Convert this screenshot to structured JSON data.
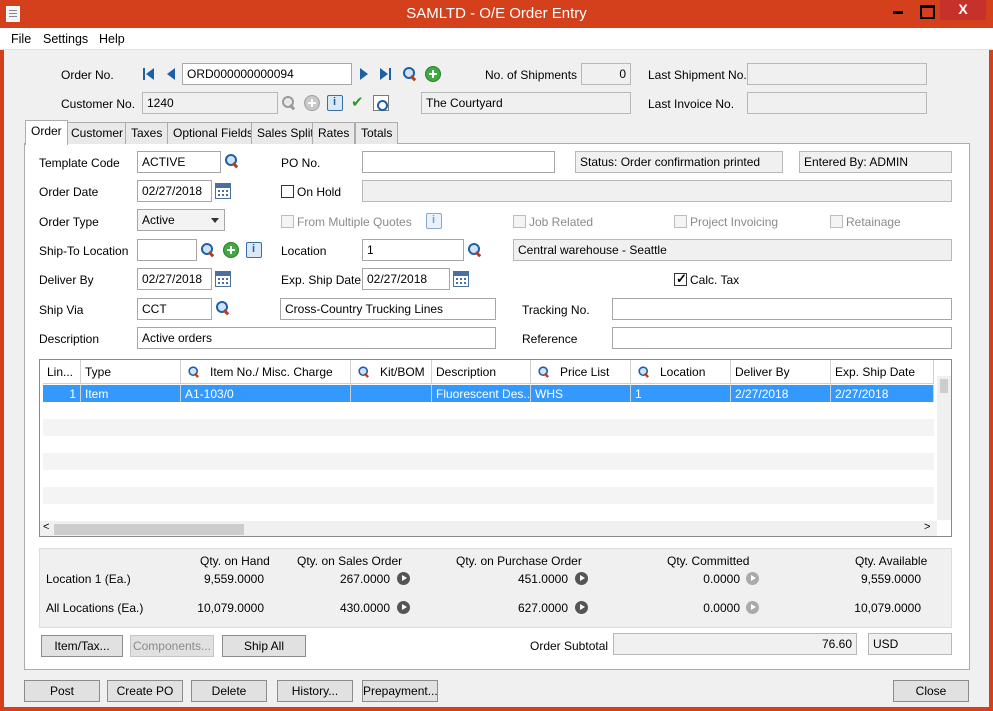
{
  "window": {
    "title": "SAMLTD - O/E Order Entry",
    "close_glyph": "X"
  },
  "menu": [
    "File",
    "Settings",
    "Help"
  ],
  "header": {
    "order_no_label": "Order No.",
    "order_no": "ORD000000000094",
    "customer_no_label": "Customer No.",
    "customer_no": "1240",
    "customer_name": "The Courtyard",
    "shipments_label": "No. of Shipments",
    "shipments": "0",
    "last_shipment_label": "Last Shipment No.",
    "last_shipment": "",
    "last_invoice_label": "Last Invoice No.",
    "last_invoice": ""
  },
  "tabs": [
    "Order",
    "Customer",
    "Taxes",
    "Optional Fields",
    "Sales Split",
    "Rates",
    "Totals"
  ],
  "order": {
    "template_code_label": "Template Code",
    "template_code": "ACTIVE",
    "po_no_label": "PO No.",
    "po_no": "",
    "status": "Status: Order confirmation printed",
    "entered_by": "Entered By: ADMIN",
    "order_date_label": "Order Date",
    "order_date": "02/27/2018",
    "on_hold_label": "On Hold",
    "on_hold_reason": "",
    "order_type_label": "Order Type",
    "order_type": "Active",
    "from_multiple_quotes_label": "From Multiple Quotes",
    "job_related_label": "Job Related",
    "project_invoicing_label": "Project Invoicing",
    "retainage_label": "Retainage",
    "ship_to_label": "Ship-To Location",
    "ship_to": "",
    "location_label": "Location",
    "location": "1",
    "location_desc": "Central warehouse - Seattle",
    "deliver_by_label": "Deliver By",
    "deliver_by": "02/27/2018",
    "exp_ship_date_label": "Exp. Ship Date",
    "exp_ship_date": "02/27/2018",
    "calc_tax_label": "Calc. Tax",
    "ship_via_label": "Ship Via",
    "ship_via": "CCT",
    "ship_via_desc": "Cross-Country Trucking Lines",
    "tracking_no_label": "Tracking No.",
    "tracking_no": "",
    "description_label": "Description",
    "description": "Active orders",
    "reference_label": "Reference",
    "reference": ""
  },
  "grid": {
    "columns": [
      "Lin...",
      "Type",
      "Item No./ Misc. Charge",
      "Kit/BOM",
      "Description",
      "Price List",
      "Location",
      "Deliver By",
      "Exp. Ship Date"
    ],
    "rows": [
      [
        "1",
        "Item",
        "A1-103/0",
        "",
        "Fluorescent Des...",
        "WHS",
        "1",
        "2/27/2018",
        "2/27/2018"
      ]
    ],
    "scroll_left": "<",
    "scroll_right": ">"
  },
  "summary": {
    "headers": [
      "Qty. on Hand",
      "Qty. on Sales Order",
      "Qty. on Purchase Order",
      "Qty. Committed",
      "Qty. Available"
    ],
    "location_row_label": "Location  1 (Ea.)",
    "location_row": [
      "9,559.0000",
      "267.0000",
      "451.0000",
      "0.0000",
      "9,559.0000"
    ],
    "all_row_label": "All Locations (Ea.)",
    "all_row": [
      "10,079.0000",
      "430.0000",
      "627.0000",
      "0.0000",
      "10,079.0000"
    ]
  },
  "panel_buttons": {
    "item_tax": "Item/Tax...",
    "components": "Components...",
    "ship_all": "Ship All"
  },
  "subtotal": {
    "label": "Order Subtotal",
    "value": "76.60",
    "currency": "USD"
  },
  "footer_buttons": {
    "post": "Post",
    "create_po": "Create PO",
    "delete": "Delete",
    "history": "History...",
    "prepayment": "Prepayment...",
    "close": "Close"
  }
}
